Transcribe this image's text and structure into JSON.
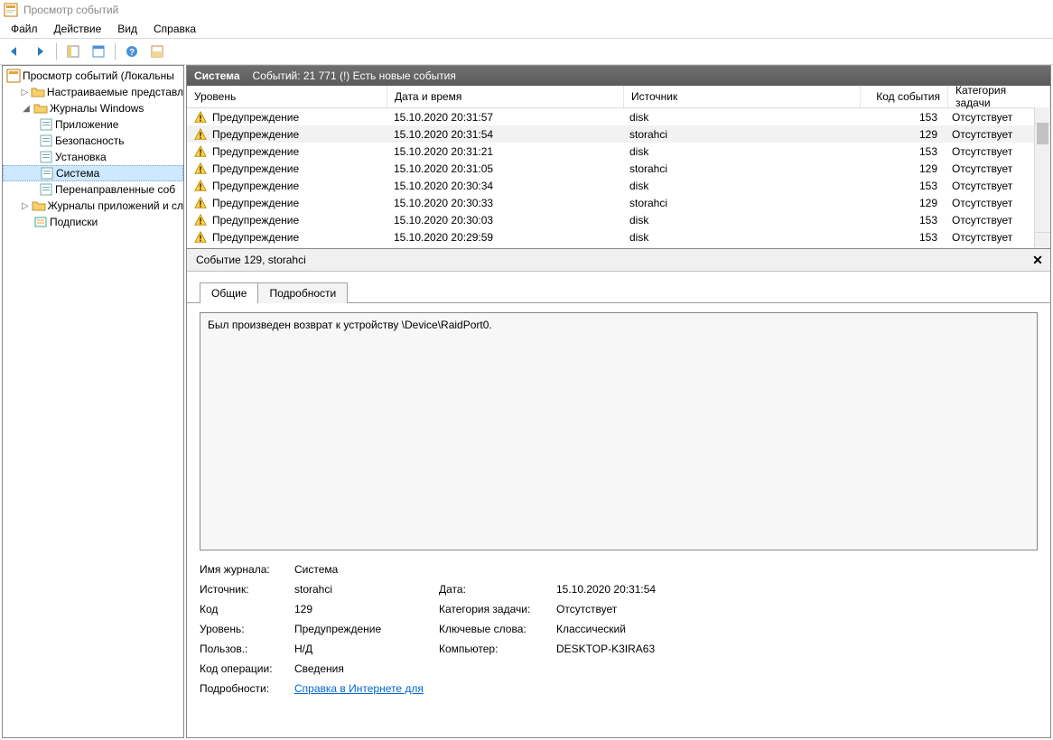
{
  "window": {
    "title": "Просмотр событий"
  },
  "menu": {
    "file": "Файл",
    "action": "Действие",
    "view": "Вид",
    "help": "Справка"
  },
  "tree": {
    "root": "Просмотр событий (Локальны",
    "custom": "Настраиваемые представл",
    "winlogs": "Журналы Windows",
    "app": "Приложение",
    "sec": "Безопасность",
    "setup": "Установка",
    "system": "Система",
    "forwarded": "Перенаправленные соб",
    "appsvc": "Журналы приложений и сл",
    "subs": "Подписки"
  },
  "pane": {
    "title": "Система",
    "count": "Событий: 21 771 (!) Есть новые события"
  },
  "grid": {
    "headers": {
      "level": "Уровень",
      "date": "Дата и время",
      "source": "Источник",
      "code": "Код события",
      "category": "Категория задачи"
    },
    "rows": [
      {
        "level": "Предупреждение",
        "date": "15.10.2020 20:31:57",
        "source": "disk",
        "code": "153",
        "category": "Отсутствует",
        "sel": false
      },
      {
        "level": "Предупреждение",
        "date": "15.10.2020 20:31:54",
        "source": "storahci",
        "code": "129",
        "category": "Отсутствует",
        "sel": true
      },
      {
        "level": "Предупреждение",
        "date": "15.10.2020 20:31:21",
        "source": "disk",
        "code": "153",
        "category": "Отсутствует",
        "sel": false
      },
      {
        "level": "Предупреждение",
        "date": "15.10.2020 20:31:05",
        "source": "storahci",
        "code": "129",
        "category": "Отсутствует",
        "sel": false
      },
      {
        "level": "Предупреждение",
        "date": "15.10.2020 20:30:34",
        "source": "disk",
        "code": "153",
        "category": "Отсутствует",
        "sel": false
      },
      {
        "level": "Предупреждение",
        "date": "15.10.2020 20:30:33",
        "source": "storahci",
        "code": "129",
        "category": "Отсутствует",
        "sel": false
      },
      {
        "level": "Предупреждение",
        "date": "15.10.2020 20:30:03",
        "source": "disk",
        "code": "153",
        "category": "Отсутствует",
        "sel": false
      },
      {
        "level": "Предупреждение",
        "date": "15.10.2020 20:29:59",
        "source": "disk",
        "code": "153",
        "category": "Отсутствует",
        "sel": false
      }
    ]
  },
  "detail": {
    "title": "Событие 129, storahci",
    "tabs": {
      "general": "Общие",
      "details": "Подробности"
    },
    "message": "Был произведен возврат к устройству \\Device\\RaidPort0.",
    "labels": {
      "logname": "Имя журнала:",
      "source": "Источник:",
      "code": "Код",
      "level": "Уровень:",
      "user": "Пользов.:",
      "opcode": "Код операции:",
      "moreinfo": "Подробности:",
      "date": "Дата:",
      "category": "Категория задачи:",
      "keywords": "Ключевые слова:",
      "computer": "Компьютер:"
    },
    "values": {
      "logname": "Система",
      "source": "storahci",
      "code": "129",
      "level": "Предупреждение",
      "user": "Н/Д",
      "opcode": "Сведения",
      "date": "15.10.2020 20:31:54",
      "category": "Отсутствует",
      "keywords": "Классический",
      "computer": "DESKTOP-K3IRA63",
      "helplink": "Справка в Интернете для "
    }
  }
}
